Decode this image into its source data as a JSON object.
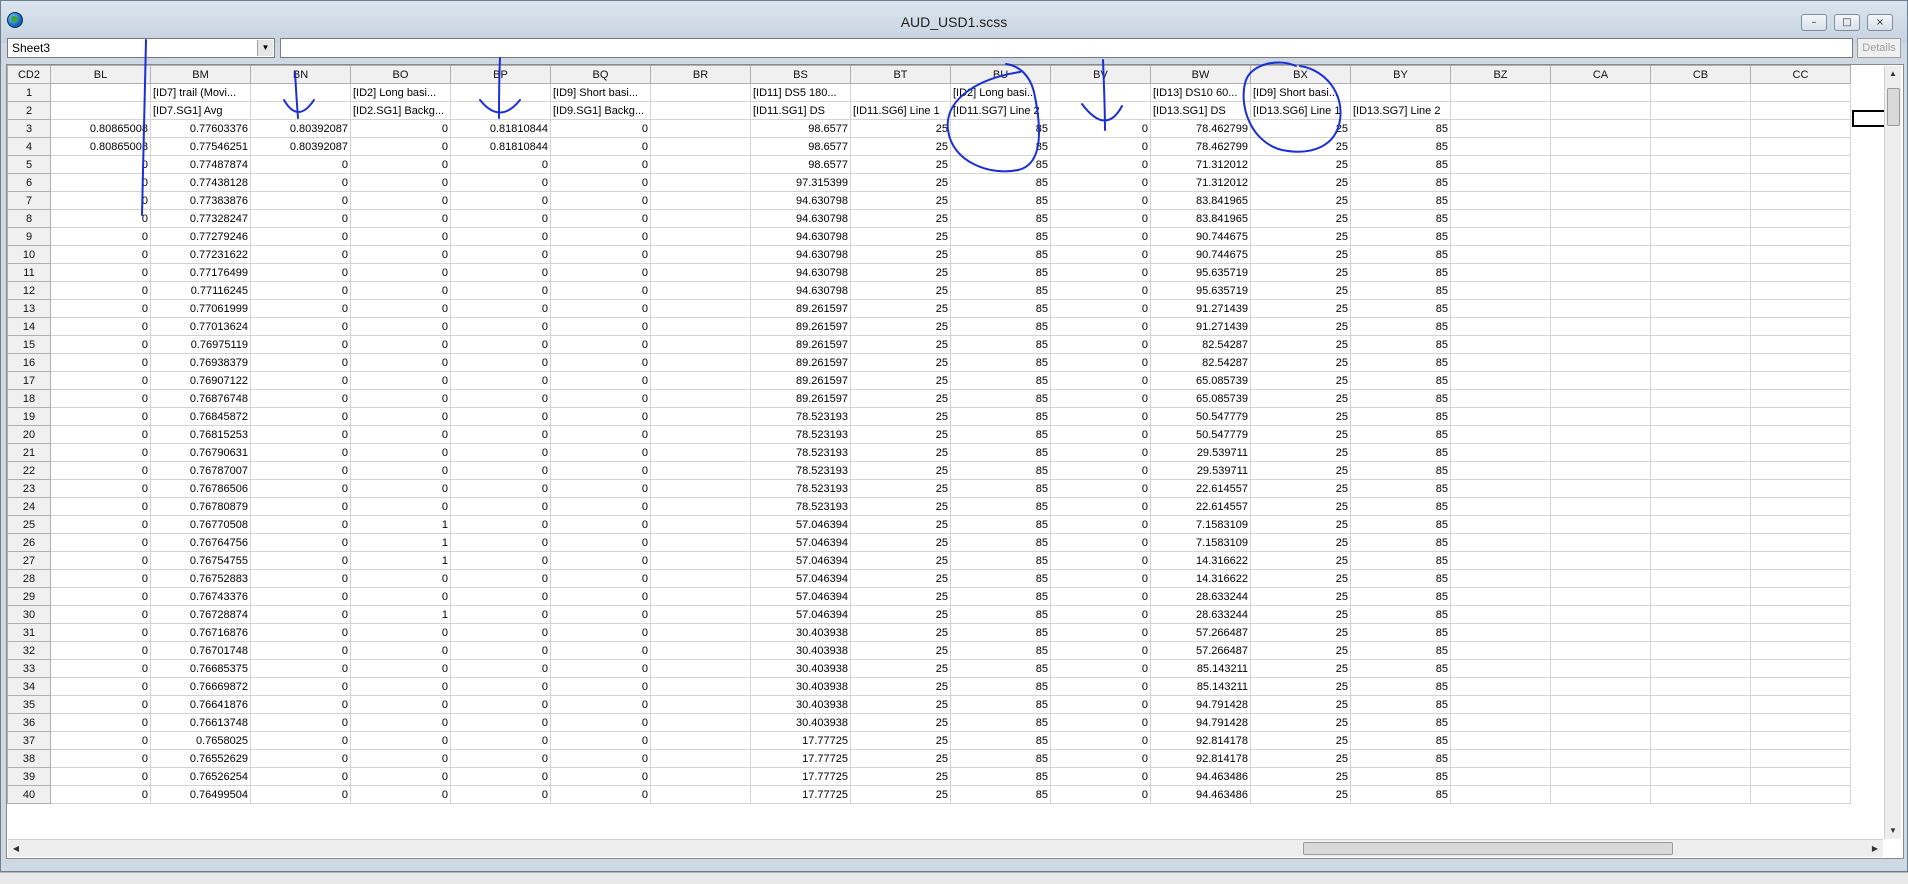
{
  "window": {
    "title": "AUD_USD1.scss"
  },
  "toolbar": {
    "sheet": "Sheet3",
    "formula": "",
    "details_label": "Details"
  },
  "grid": {
    "corner": "CD2",
    "columns": [
      "BL",
      "BM",
      "BN",
      "BO",
      "BP",
      "BQ",
      "BR",
      "BS",
      "BT",
      "BU",
      "BV",
      "BW",
      "BX",
      "BY",
      "BZ",
      "CA",
      "CB",
      "CC"
    ],
    "rows": [
      {
        "n": "1",
        "cells": [
          "",
          "[ID7] trail (Movi...",
          "",
          "[ID2] Long basi...",
          "",
          "[ID9] Short basi...",
          "",
          "[ID11] DS5 180...",
          "",
          "[ID2] Long basi...",
          "",
          "[ID13] DS10 60...",
          "[ID9] Short basi...",
          "",
          "",
          "",
          "",
          ""
        ]
      },
      {
        "n": "2",
        "cells": [
          "",
          "[ID7.SG1] Avg",
          "",
          "[ID2.SG1] Backg...",
          "",
          "[ID9.SG1] Backg...",
          "",
          "[ID11.SG1] DS",
          "[ID11.SG6] Line 1",
          "[ID11.SG7] Line 2",
          "",
          "[ID13.SG1] DS",
          "[ID13.SG6] Line 1",
          "[ID13.SG7] Line 2",
          "",
          "",
          "",
          ""
        ]
      },
      {
        "n": "3",
        "cells": [
          "0.80865008",
          "0.77603376",
          "0.80392087",
          "0",
          "0.81810844",
          "0",
          "",
          "98.6577",
          "25",
          "85",
          "0",
          "78.462799",
          "25",
          "85",
          "",
          "",
          "",
          ""
        ]
      },
      {
        "n": "4",
        "cells": [
          "0.80865008",
          "0.77546251",
          "0.80392087",
          "0",
          "0.81810844",
          "0",
          "",
          "98.6577",
          "25",
          "85",
          "0",
          "78.462799",
          "25",
          "85",
          "",
          "",
          "",
          ""
        ]
      },
      {
        "n": "5",
        "cells": [
          "0",
          "0.77487874",
          "0",
          "0",
          "0",
          "0",
          "",
          "98.6577",
          "25",
          "85",
          "0",
          "71.312012",
          "25",
          "85",
          "",
          "",
          "",
          ""
        ]
      },
      {
        "n": "6",
        "cells": [
          "0",
          "0.77438128",
          "0",
          "0",
          "0",
          "0",
          "",
          "97.315399",
          "25",
          "85",
          "0",
          "71.312012",
          "25",
          "85",
          "",
          "",
          "",
          ""
        ]
      },
      {
        "n": "7",
        "cells": [
          "0",
          "0.77383876",
          "0",
          "0",
          "0",
          "0",
          "",
          "94.630798",
          "25",
          "85",
          "0",
          "83.841965",
          "25",
          "85",
          "",
          "",
          "",
          ""
        ]
      },
      {
        "n": "8",
        "cells": [
          "0",
          "0.77328247",
          "0",
          "0",
          "0",
          "0",
          "",
          "94.630798",
          "25",
          "85",
          "0",
          "83.841965",
          "25",
          "85",
          "",
          "",
          "",
          ""
        ]
      },
      {
        "n": "9",
        "cells": [
          "0",
          "0.77279246",
          "0",
          "0",
          "0",
          "0",
          "",
          "94.630798",
          "25",
          "85",
          "0",
          "90.744675",
          "25",
          "85",
          "",
          "",
          "",
          ""
        ]
      },
      {
        "n": "10",
        "cells": [
          "0",
          "0.77231622",
          "0",
          "0",
          "0",
          "0",
          "",
          "94.630798",
          "25",
          "85",
          "0",
          "90.744675",
          "25",
          "85",
          "",
          "",
          "",
          ""
        ]
      },
      {
        "n": "11",
        "cells": [
          "0",
          "0.77176499",
          "0",
          "0",
          "0",
          "0",
          "",
          "94.630798",
          "25",
          "85",
          "0",
          "95.635719",
          "25",
          "85",
          "",
          "",
          "",
          ""
        ]
      },
      {
        "n": "12",
        "cells": [
          "0",
          "0.77116245",
          "0",
          "0",
          "0",
          "0",
          "",
          "94.630798",
          "25",
          "85",
          "0",
          "95.635719",
          "25",
          "85",
          "",
          "",
          "",
          ""
        ]
      },
      {
        "n": "13",
        "cells": [
          "0",
          "0.77061999",
          "0",
          "0",
          "0",
          "0",
          "",
          "89.261597",
          "25",
          "85",
          "0",
          "91.271439",
          "25",
          "85",
          "",
          "",
          "",
          ""
        ]
      },
      {
        "n": "14",
        "cells": [
          "0",
          "0.77013624",
          "0",
          "0",
          "0",
          "0",
          "",
          "89.261597",
          "25",
          "85",
          "0",
          "91.271439",
          "25",
          "85",
          "",
          "",
          "",
          ""
        ]
      },
      {
        "n": "15",
        "cells": [
          "0",
          "0.76975119",
          "0",
          "0",
          "0",
          "0",
          "",
          "89.261597",
          "25",
          "85",
          "0",
          "82.54287",
          "25",
          "85",
          "",
          "",
          "",
          ""
        ]
      },
      {
        "n": "16",
        "cells": [
          "0",
          "0.76938379",
          "0",
          "0",
          "0",
          "0",
          "",
          "89.261597",
          "25",
          "85",
          "0",
          "82.54287",
          "25",
          "85",
          "",
          "",
          "",
          ""
        ]
      },
      {
        "n": "17",
        "cells": [
          "0",
          "0.76907122",
          "0",
          "0",
          "0",
          "0",
          "",
          "89.261597",
          "25",
          "85",
          "0",
          "65.085739",
          "25",
          "85",
          "",
          "",
          "",
          ""
        ]
      },
      {
        "n": "18",
        "cells": [
          "0",
          "0.76876748",
          "0",
          "0",
          "0",
          "0",
          "",
          "89.261597",
          "25",
          "85",
          "0",
          "65.085739",
          "25",
          "85",
          "",
          "",
          "",
          ""
        ]
      },
      {
        "n": "19",
        "cells": [
          "0",
          "0.76845872",
          "0",
          "0",
          "0",
          "0",
          "",
          "78.523193",
          "25",
          "85",
          "0",
          "50.547779",
          "25",
          "85",
          "",
          "",
          "",
          ""
        ]
      },
      {
        "n": "20",
        "cells": [
          "0",
          "0.76815253",
          "0",
          "0",
          "0",
          "0",
          "",
          "78.523193",
          "25",
          "85",
          "0",
          "50.547779",
          "25",
          "85",
          "",
          "",
          "",
          ""
        ]
      },
      {
        "n": "21",
        "cells": [
          "0",
          "0.76790631",
          "0",
          "0",
          "0",
          "0",
          "",
          "78.523193",
          "25",
          "85",
          "0",
          "29.539711",
          "25",
          "85",
          "",
          "",
          "",
          ""
        ]
      },
      {
        "n": "22",
        "cells": [
          "0",
          "0.76787007",
          "0",
          "0",
          "0",
          "0",
          "",
          "78.523193",
          "25",
          "85",
          "0",
          "29.539711",
          "25",
          "85",
          "",
          "",
          "",
          ""
        ]
      },
      {
        "n": "23",
        "cells": [
          "0",
          "0.76786506",
          "0",
          "0",
          "0",
          "0",
          "",
          "78.523193",
          "25",
          "85",
          "0",
          "22.614557",
          "25",
          "85",
          "",
          "",
          "",
          ""
        ]
      },
      {
        "n": "24",
        "cells": [
          "0",
          "0.76780879",
          "0",
          "0",
          "0",
          "0",
          "",
          "78.523193",
          "25",
          "85",
          "0",
          "22.614557",
          "25",
          "85",
          "",
          "",
          "",
          ""
        ]
      },
      {
        "n": "25",
        "cells": [
          "0",
          "0.76770508",
          "0",
          "1",
          "0",
          "0",
          "",
          "57.046394",
          "25",
          "85",
          "0",
          "7.1583109",
          "25",
          "85",
          "",
          "",
          "",
          ""
        ]
      },
      {
        "n": "26",
        "cells": [
          "0",
          "0.76764756",
          "0",
          "1",
          "0",
          "0",
          "",
          "57.046394",
          "25",
          "85",
          "0",
          "7.1583109",
          "25",
          "85",
          "",
          "",
          "",
          ""
        ]
      },
      {
        "n": "27",
        "cells": [
          "0",
          "0.76754755",
          "0",
          "1",
          "0",
          "0",
          "",
          "57.046394",
          "25",
          "85",
          "0",
          "14.316622",
          "25",
          "85",
          "",
          "",
          "",
          ""
        ]
      },
      {
        "n": "28",
        "cells": [
          "0",
          "0.76752883",
          "0",
          "0",
          "0",
          "0",
          "",
          "57.046394",
          "25",
          "85",
          "0",
          "14.316622",
          "25",
          "85",
          "",
          "",
          "",
          ""
        ]
      },
      {
        "n": "29",
        "cells": [
          "0",
          "0.76743376",
          "0",
          "0",
          "0",
          "0",
          "",
          "57.046394",
          "25",
          "85",
          "0",
          "28.633244",
          "25",
          "85",
          "",
          "",
          "",
          ""
        ]
      },
      {
        "n": "30",
        "cells": [
          "0",
          "0.76728874",
          "0",
          "1",
          "0",
          "0",
          "",
          "57.046394",
          "25",
          "85",
          "0",
          "28.633244",
          "25",
          "85",
          "",
          "",
          "",
          ""
        ]
      },
      {
        "n": "31",
        "cells": [
          "0",
          "0.76716876",
          "0",
          "0",
          "0",
          "0",
          "",
          "30.403938",
          "25",
          "85",
          "0",
          "57.266487",
          "25",
          "85",
          "",
          "",
          "",
          ""
        ]
      },
      {
        "n": "32",
        "cells": [
          "0",
          "0.76701748",
          "0",
          "0",
          "0",
          "0",
          "",
          "30.403938",
          "25",
          "85",
          "0",
          "57.266487",
          "25",
          "85",
          "",
          "",
          "",
          ""
        ]
      },
      {
        "n": "33",
        "cells": [
          "0",
          "0.76685375",
          "0",
          "0",
          "0",
          "0",
          "",
          "30.403938",
          "25",
          "85",
          "0",
          "85.143211",
          "25",
          "85",
          "",
          "",
          "",
          ""
        ]
      },
      {
        "n": "34",
        "cells": [
          "0",
          "0.76669872",
          "0",
          "0",
          "0",
          "0",
          "",
          "30.403938",
          "25",
          "85",
          "0",
          "85.143211",
          "25",
          "85",
          "",
          "",
          "",
          ""
        ]
      },
      {
        "n": "35",
        "cells": [
          "0",
          "0.76641876",
          "0",
          "0",
          "0",
          "0",
          "",
          "30.403938",
          "25",
          "85",
          "0",
          "94.791428",
          "25",
          "85",
          "",
          "",
          "",
          ""
        ]
      },
      {
        "n": "36",
        "cells": [
          "0",
          "0.76613748",
          "0",
          "0",
          "0",
          "0",
          "",
          "30.403938",
          "25",
          "85",
          "0",
          "94.791428",
          "25",
          "85",
          "",
          "",
          "",
          ""
        ]
      },
      {
        "n": "37",
        "cells": [
          "0",
          "0.7658025",
          "0",
          "0",
          "0",
          "0",
          "",
          "17.77725",
          "25",
          "85",
          "0",
          "92.814178",
          "25",
          "85",
          "",
          "",
          "",
          ""
        ]
      },
      {
        "n": "38",
        "cells": [
          "0",
          "0.76552629",
          "0",
          "0",
          "0",
          "0",
          "",
          "17.77725",
          "25",
          "85",
          "0",
          "92.814178",
          "25",
          "85",
          "",
          "",
          "",
          ""
        ]
      },
      {
        "n": "39",
        "cells": [
          "0",
          "0.76526254",
          "0",
          "0",
          "0",
          "0",
          "",
          "17.77725",
          "25",
          "85",
          "0",
          "94.463486",
          "25",
          "85",
          "",
          "",
          "",
          ""
        ]
      },
      {
        "n": "40",
        "cells": [
          "0",
          "0.76499504",
          "0",
          "0",
          "0",
          "0",
          "",
          "17.77725",
          "25",
          "85",
          "0",
          "94.463486",
          "25",
          "85",
          "",
          "",
          "",
          ""
        ]
      }
    ]
  },
  "annotations": {
    "ink_color": "#1a2fd6"
  }
}
